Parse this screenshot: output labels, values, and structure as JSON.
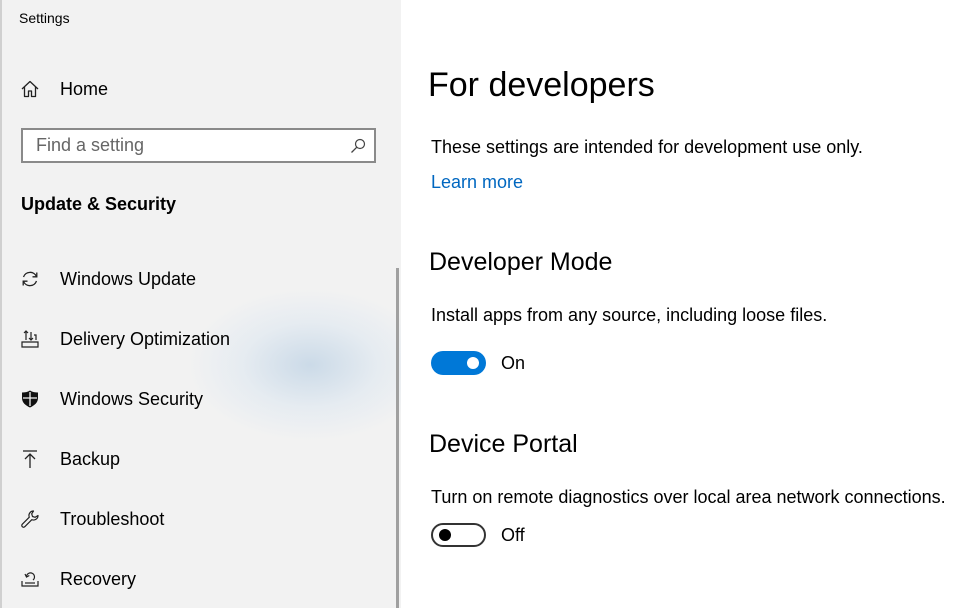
{
  "window": {
    "title": "Settings"
  },
  "sidebar": {
    "home_label": "Home",
    "search": {
      "placeholder": "Find a setting",
      "value": ""
    },
    "section_title": "Update & Security",
    "items": [
      {
        "label": "Windows Update",
        "icon": "sync-icon"
      },
      {
        "label": "Delivery Optimization",
        "icon": "delivery-optimization-icon"
      },
      {
        "label": "Windows Security",
        "icon": "shield-icon"
      },
      {
        "label": "Backup",
        "icon": "backup-arrow-icon"
      },
      {
        "label": "Troubleshoot",
        "icon": "wrench-icon"
      },
      {
        "label": "Recovery",
        "icon": "recovery-icon"
      }
    ]
  },
  "main": {
    "title": "For developers",
    "intro": "These settings are intended for development use only.",
    "learn_more": "Learn more",
    "developer_mode": {
      "heading": "Developer Mode",
      "description": "Install apps from any source, including loose files.",
      "state": "On",
      "enabled": true
    },
    "device_portal": {
      "heading": "Device Portal",
      "description": "Turn on remote diagnostics over local area network connections.",
      "state": "Off",
      "enabled": false
    }
  },
  "colors": {
    "accent": "#0078d7",
    "link": "#0067c0",
    "sidebar_bg": "#f2f2f2"
  }
}
